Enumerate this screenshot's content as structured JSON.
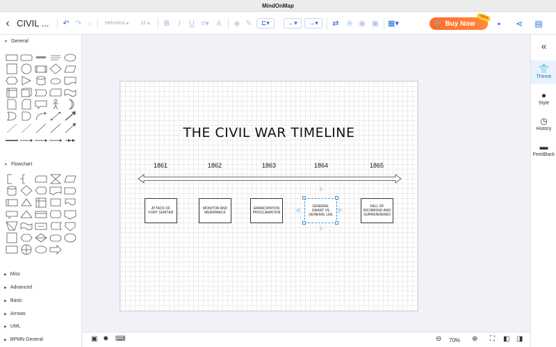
{
  "window": {
    "title": "MindOnMap"
  },
  "toolbar": {
    "doc_title": "CIVIL ...",
    "font_family": "Helvetica",
    "font_size": "12",
    "buy_label": "Buy Now",
    "buy_badge": "-60%"
  },
  "left_panel": {
    "categories": [
      "General",
      "Flowchart",
      "Misc",
      "Advanced",
      "Basic",
      "Arrows",
      "UML",
      "BPMN General"
    ]
  },
  "diagram": {
    "title": "THE CIVIL WAR TIMELINE",
    "years": [
      "1861",
      "1862",
      "1863",
      "1864",
      "1865"
    ],
    "events": [
      "ATTACK OF FORT SUMTER",
      "MONITOR AND MERRIMACK",
      "EMANCIPATION PROCLAMATION",
      "GENERAL GRANT VS GENERAL LEE",
      "FALL OF RICHMOND AND SURRENDERED"
    ]
  },
  "right_panel": {
    "items": [
      "Theme",
      "Style",
      "History",
      "FeedBack"
    ]
  },
  "bottom_bar": {
    "zoom": "70%"
  },
  "colors": {
    "accent": "#2a6edb",
    "buy": "#ff6b2c",
    "selection": "#3a8fd6",
    "canvas_bg": "#f4f0f8"
  }
}
